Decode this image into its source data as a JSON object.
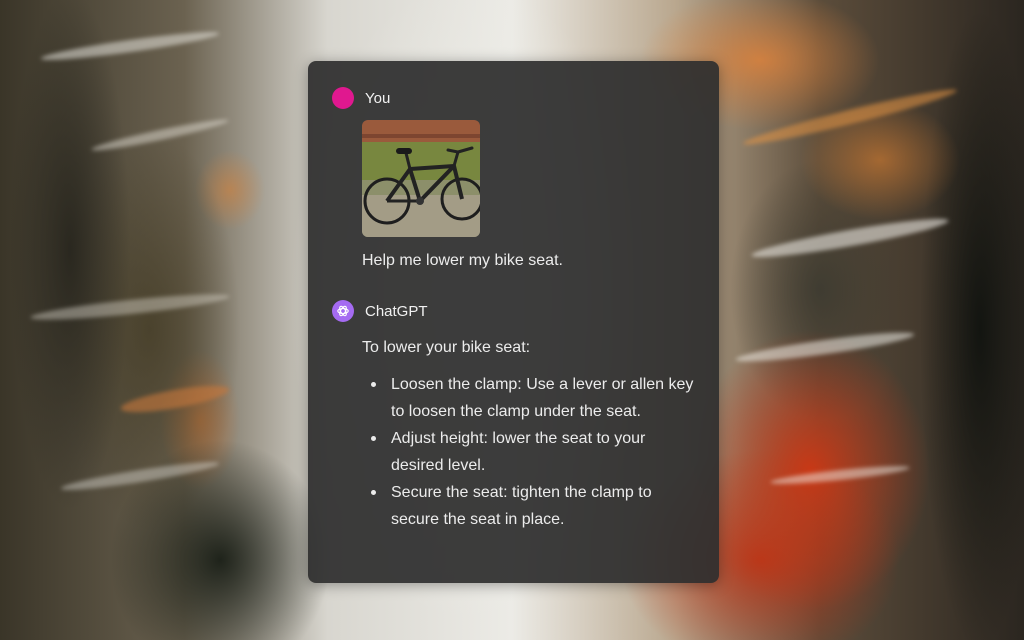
{
  "conversation": {
    "user_message": {
      "sender": "You",
      "avatar_color": "#e0188f",
      "attachment": "bicycle photo",
      "text": "Help me lower my bike seat."
    },
    "assistant_message": {
      "sender": "ChatGPT",
      "avatar_color": "#a56bf2",
      "avatar_icon": "openai-logo-icon",
      "intro": "To lower your bike seat:",
      "steps": [
        "Loosen the clamp: Use a lever or allen key to loosen the clamp under the seat.",
        "Adjust height: lower the seat to your desired level.",
        "Secure the seat: tighten the clamp to secure the seat in place."
      ]
    }
  }
}
